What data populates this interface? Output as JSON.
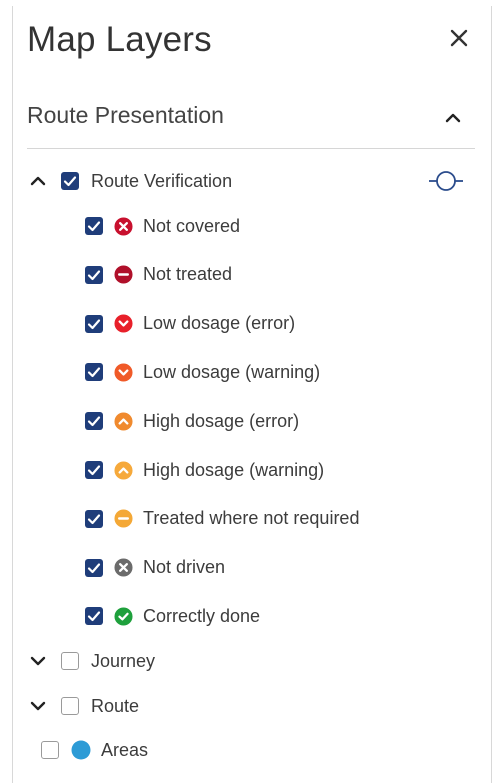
{
  "header": {
    "title": "Map Layers"
  },
  "section": {
    "title": "Route Presentation"
  },
  "group": {
    "label": "Route Verification",
    "items": [
      {
        "label": "Not covered",
        "color": "#c8102e",
        "icon": "x-circle-icon"
      },
      {
        "label": "Not treated",
        "color": "#b0102a",
        "icon": "minus-circle-icon"
      },
      {
        "label": "Low dosage (error)",
        "color": "#e8202a",
        "icon": "chevron-down-circle-icon"
      },
      {
        "label": "Low dosage (warning)",
        "color": "#f05a28",
        "icon": "chevron-down-circle-icon"
      },
      {
        "label": "High dosage (error)",
        "color": "#f08a2e",
        "icon": "chevron-up-circle-icon"
      },
      {
        "label": "High dosage (warning)",
        "color": "#f6a93b",
        "icon": "chevron-up-circle-icon"
      },
      {
        "label": "Treated where not required",
        "color": "#f4a836",
        "icon": "minus-circle-icon"
      },
      {
        "label": "Not driven",
        "color": "#6b6b6b",
        "icon": "x-circle-icon"
      },
      {
        "label": "Correctly done",
        "color": "#1ea03c",
        "icon": "check-circle-icon"
      }
    ]
  },
  "layers": {
    "journey": "Journey",
    "route": "Route",
    "areas": "Areas",
    "areas_color": "#2d9bd6"
  },
  "colors": {
    "accent": "#1f3d7a",
    "target": "#2b4c8c"
  }
}
